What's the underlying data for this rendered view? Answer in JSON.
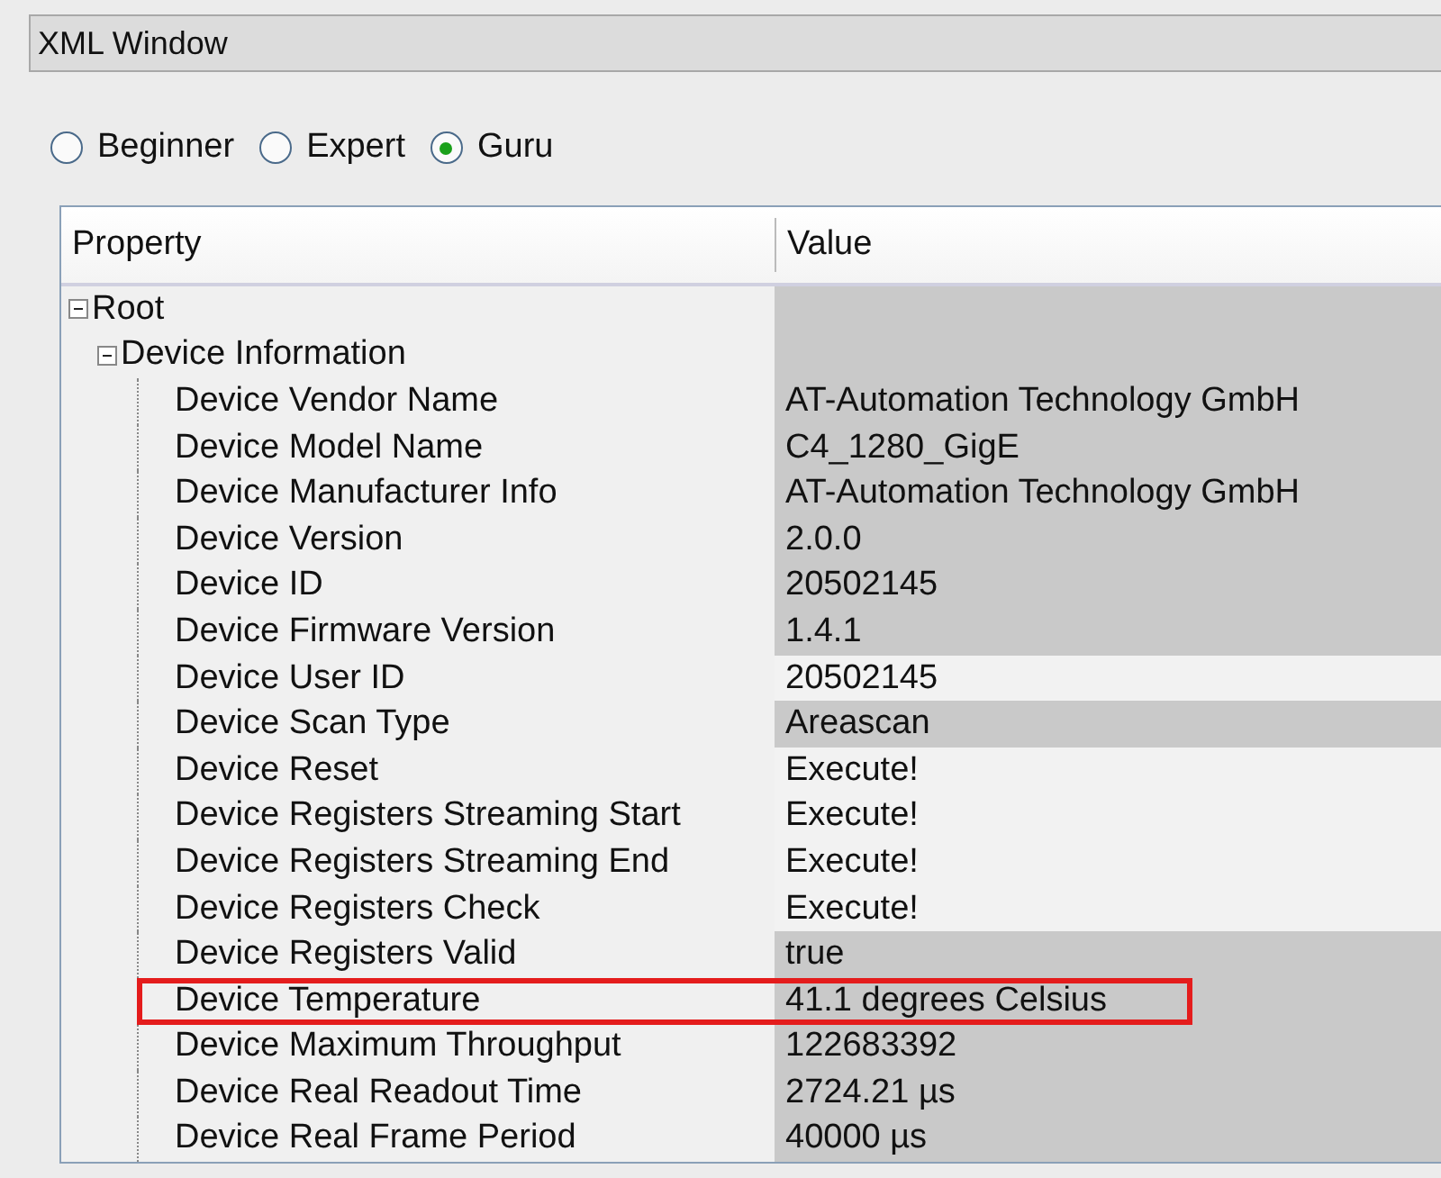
{
  "window": {
    "title": "XML Window"
  },
  "modes": [
    {
      "label": "Beginner",
      "selected": false
    },
    {
      "label": "Expert",
      "selected": false
    },
    {
      "label": "Guru",
      "selected": true
    }
  ],
  "table": {
    "columns": [
      "Property",
      "Value"
    ],
    "tree": [
      {
        "label": "Root",
        "read_only": true,
        "expanded": true,
        "children": [
          {
            "label": "Device Information",
            "read_only": true,
            "expanded": true,
            "children": [
              {
                "label": "Device Vendor Name",
                "value": "AT-Automation Technology GmbH",
                "read_only": true,
                "highlighted": false
              },
              {
                "label": "Device Model Name",
                "value": "C4_1280_GigE",
                "read_only": true,
                "highlighted": false
              },
              {
                "label": "Device Manufacturer Info",
                "value": "AT-Automation Technology GmbH",
                "read_only": true,
                "highlighted": false
              },
              {
                "label": "Device Version",
                "value": "2.0.0",
                "read_only": true,
                "highlighted": false
              },
              {
                "label": "Device ID",
                "value": "20502145",
                "read_only": true,
                "highlighted": false
              },
              {
                "label": "Device Firmware Version",
                "value": "1.4.1",
                "read_only": true,
                "highlighted": false
              },
              {
                "label": "Device User ID",
                "value": "20502145",
                "read_only": false,
                "highlighted": false
              },
              {
                "label": "Device Scan Type",
                "value": "Areascan",
                "read_only": true,
                "highlighted": false
              },
              {
                "label": "Device Reset",
                "value": "Execute!",
                "read_only": false,
                "highlighted": false
              },
              {
                "label": "Device Registers Streaming Start",
                "value": "Execute!",
                "read_only": false,
                "highlighted": false
              },
              {
                "label": "Device Registers Streaming End",
                "value": "Execute!",
                "read_only": false,
                "highlighted": false
              },
              {
                "label": "Device Registers Check",
                "value": "Execute!",
                "read_only": false,
                "highlighted": false
              },
              {
                "label": "Device Registers Valid",
                "value": "true",
                "read_only": true,
                "highlighted": false
              },
              {
                "label": "Device Temperature",
                "value": "41.1 degrees Celsius",
                "read_only": true,
                "highlighted": true
              },
              {
                "label": "Device Maximum Throughput",
                "value": "122683392",
                "read_only": true,
                "highlighted": false
              },
              {
                "label": "Device Real Readout Time",
                "value": "2724.21 µs",
                "read_only": true,
                "highlighted": false
              },
              {
                "label": "Device Real Frame Period",
                "value": "40000 µs",
                "read_only": true,
                "highlighted": false
              }
            ]
          }
        ]
      }
    ]
  }
}
